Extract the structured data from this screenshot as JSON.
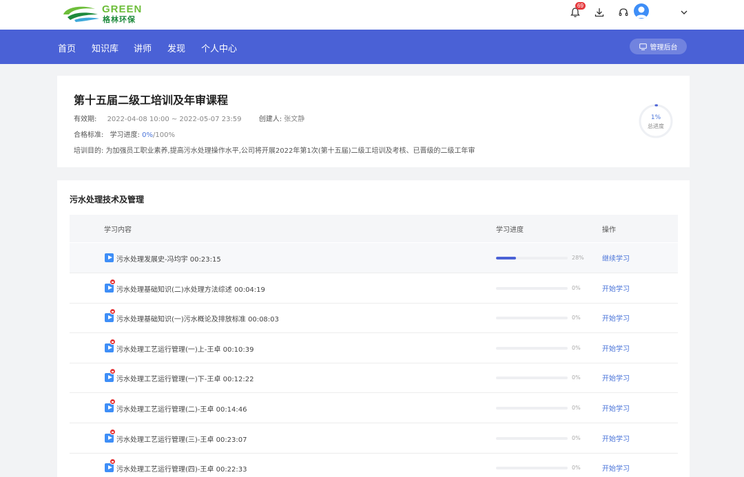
{
  "brand": {
    "en": "GREEN",
    "cn": "格林环保"
  },
  "header": {
    "notification_count": "69"
  },
  "nav": {
    "items": [
      "首页",
      "知识库",
      "讲师",
      "发现",
      "个人中心"
    ],
    "admin_label": "管理后台"
  },
  "course": {
    "title": "第十五届二级工培训及年审课程",
    "validity_label": "有效期:",
    "validity_value": "2022-04-08 10:00 ~ 2022-05-07 23:59",
    "creator_label": "创建人:",
    "creator_value": "张文静",
    "standard_label": "合格标准:",
    "standard_text": "学习进度:",
    "standard_progress": "0%",
    "standard_target": "/100%",
    "purpose_label": "培训目的:",
    "purpose_value": "为加强员工职业素养,提高污水处理操作水平,公司将开展2022年第1次(第十五届)二级工培训及考核、已晋级的二级工年审",
    "total_progress": "1%",
    "total_progress_value": 0.01,
    "total_progress_label": "总进度"
  },
  "section": {
    "title": "污水处理技术及管理",
    "columns": {
      "content": "学习内容",
      "progress": "学习进度",
      "action": "操作"
    },
    "rows": [
      {
        "title": "污水处理发展史-冯均宇 00:23:15",
        "progress": "28%",
        "progress_value": 0.28,
        "action": "继续学习",
        "locked": false
      },
      {
        "title": "污水处理基础知识(二)水处理方法综述 00:04:19",
        "progress": "0%",
        "progress_value": 0,
        "action": "开始学习",
        "locked": true
      },
      {
        "title": "污水处理基础知识(一)污水概论及排放标准 00:08:03",
        "progress": "0%",
        "progress_value": 0,
        "action": "开始学习",
        "locked": true
      },
      {
        "title": "污水处理工艺运行管理(一)上-王卓 00:10:39",
        "progress": "0%",
        "progress_value": 0,
        "action": "开始学习",
        "locked": true
      },
      {
        "title": "污水处理工艺运行管理(一)下-王卓 00:12:22",
        "progress": "0%",
        "progress_value": 0,
        "action": "开始学习",
        "locked": true
      },
      {
        "title": "污水处理工艺运行管理(二)-王卓 00:14:46",
        "progress": "0%",
        "progress_value": 0,
        "action": "开始学习",
        "locked": true
      },
      {
        "title": "污水处理工艺运行管理(三)-王卓 00:23:07",
        "progress": "0%",
        "progress_value": 0,
        "action": "开始学习",
        "locked": true
      },
      {
        "title": "污水处理工艺运行管理(四)-王卓 00:22:33",
        "progress": "0%",
        "progress_value": 0,
        "action": "开始学习",
        "locked": true
      }
    ]
  },
  "colors": {
    "primary": "#4a61d6",
    "link": "#4a74d9",
    "badge": "#e6393d",
    "logo_green": "#6dbe3a"
  },
  "icons": [
    "bell-icon",
    "download-icon",
    "headset-icon",
    "avatar-icon",
    "chevron-down-icon",
    "monitor-icon",
    "play-icon",
    "lock-icon"
  ]
}
